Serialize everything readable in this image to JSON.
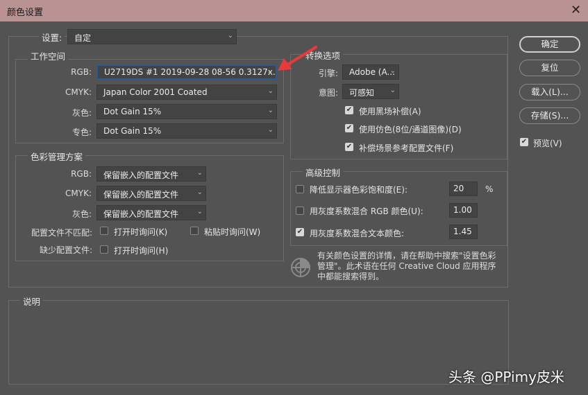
{
  "window": {
    "title": "颜色设置",
    "close": "✕"
  },
  "settings": {
    "label": "设置:",
    "value": "自定"
  },
  "workspace": {
    "title": "工作空间",
    "rows": [
      {
        "label": "RGB:",
        "value": "U2719DS #1 2019-09-28 08-56 0.3127x..."
      },
      {
        "label": "CMYK:",
        "value": "Japan Color 2001 Coated"
      },
      {
        "label": "灰色:",
        "value": "Dot Gain 15%"
      },
      {
        "label": "专色:",
        "value": "Dot Gain 15%"
      }
    ]
  },
  "policies": {
    "title": "色彩管理方案",
    "rows": [
      {
        "label": "RGB:",
        "value": "保留嵌入的配置文件"
      },
      {
        "label": "CMYK:",
        "value": "保留嵌入的配置文件"
      },
      {
        "label": "灰色:",
        "value": "保留嵌入的配置文件"
      }
    ],
    "mismatch_label": "配置文件不匹配:",
    "ask_open": "打开时询问(K)",
    "ask_paste": "粘贴时询问(W)",
    "missing_label": "缺少配置文件:",
    "missing_ask_open": "打开时询问(H)"
  },
  "conversion": {
    "title": "转换选项",
    "engine_label": "引擎:",
    "engine": "Adobe (A...",
    "intent_label": "意图:",
    "intent": "可感知",
    "checks": [
      {
        "label": "使用黑场补偿(A)",
        "checked": true
      },
      {
        "label": "使用仿色(8位/通道图像)(D)",
        "checked": true
      },
      {
        "label": "补偿场景参考配置文件(F)",
        "checked": true
      }
    ]
  },
  "advanced": {
    "title": "高级控制",
    "rows": [
      {
        "label": "降低显示器色彩饱和度(E):",
        "value": "20",
        "unit": "%",
        "checked": false
      },
      {
        "label": "用灰度系数混合 RGB 颜色(U):",
        "value": "1.00",
        "checked": false
      },
      {
        "label": "用灰度系数混合文本颜色:",
        "value": "1.45",
        "checked": true
      }
    ]
  },
  "info": {
    "text": "有关颜色设置的详情，请在帮助中搜索\"设置色彩管理\"。此术语在任何 Creative Cloud 应用程序中都能搜索得到。"
  },
  "description": {
    "title": "说明"
  },
  "buttons": {
    "ok": "确定",
    "reset": "复位",
    "load": "载入(L)...",
    "save": "存储(S)..."
  },
  "preview": {
    "label": "预览(V)",
    "checked": true
  },
  "watermark": "头条 @PPimy皮米",
  "check_glyph": "✔",
  "chev": "⌄"
}
